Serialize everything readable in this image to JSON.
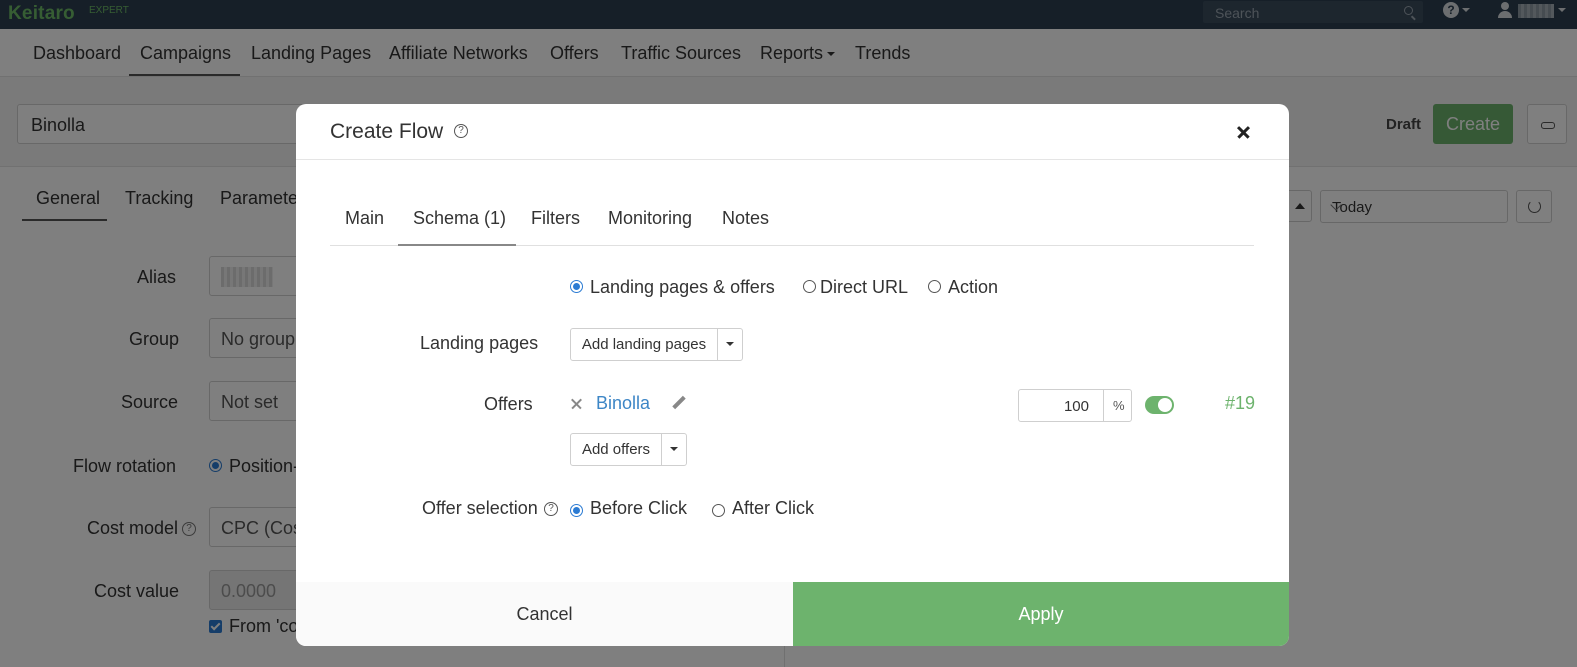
{
  "app": {
    "logo": "Keitaro",
    "badge": "EXPERT",
    "search_placeholder": "Search"
  },
  "nav": [
    "Dashboard",
    "Campaigns",
    "Landing Pages",
    "Affiliate Networks",
    "Offers",
    "Traffic Sources",
    "Reports",
    "Trends"
  ],
  "campaign": {
    "name": "Binolla",
    "status": "Draft",
    "create_label": "Create"
  },
  "subtabs": [
    "General",
    "Tracking",
    "Paramete"
  ],
  "period": "Today",
  "form": {
    "alias_label": "Alias",
    "group_label": "Group",
    "group_value": "No group",
    "source_label": "Source",
    "source_value": "Not set",
    "rotation_label": "Flow rotation",
    "rotation_value": "Position-",
    "cost_model_label": "Cost model",
    "cost_model_value": "CPC (Cos",
    "cost_value_label": "Cost value",
    "cost_value": "0.0000",
    "from_label": "From 'co"
  },
  "modal": {
    "title": "Create Flow",
    "tabs": [
      "Main",
      "Schema (1)",
      "Filters",
      "Monitoring",
      "Notes"
    ],
    "schema_options": [
      "Landing pages & offers",
      "Direct URL",
      "Action"
    ],
    "landing_pages_label": "Landing pages",
    "add_landing_label": "Add landing pages",
    "offers_label": "Offers",
    "offer": {
      "name": "Binolla",
      "weight": "100",
      "unit": "%",
      "id": "#19",
      "enabled": true
    },
    "add_offers_label": "Add offers",
    "offer_selection_label": "Offer selection",
    "offer_selection_options": [
      "Before Click",
      "After Click"
    ],
    "cancel_label": "Cancel",
    "apply_label": "Apply"
  },
  "colors": {
    "brand": "#6db36d",
    "topbar": "#2c3e50",
    "link": "#3d86c6",
    "radio": "#2b7bd3"
  }
}
